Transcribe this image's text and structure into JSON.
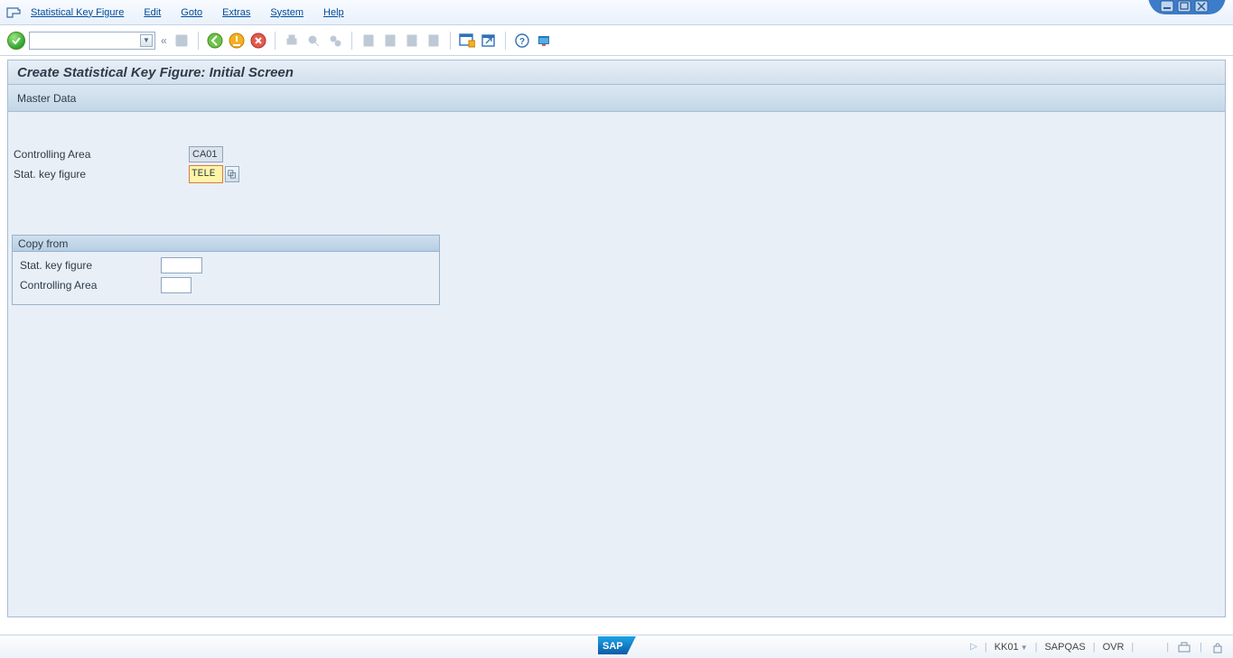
{
  "menu": {
    "items": [
      "Statistical Key Figure",
      "Edit",
      "Goto",
      "Extras",
      "System",
      "Help"
    ]
  },
  "title": "Create Statistical Key Figure: Initial Screen",
  "app_toolbar": {
    "button1": "Master Data"
  },
  "fields": {
    "controlling_area": {
      "label": "Controlling Area",
      "value": "CA01"
    },
    "stat_key_figure": {
      "label": "Stat. key figure",
      "value": "TELE"
    }
  },
  "groupbox": {
    "title": "Copy from",
    "stat_key_figure": {
      "label": "Stat. key figure",
      "value": ""
    },
    "controlling_area": {
      "label": "Controlling Area",
      "value": ""
    }
  },
  "statusbar": {
    "tcode": "KK01",
    "system": "SAPQAS",
    "insert_mode": "OVR"
  }
}
